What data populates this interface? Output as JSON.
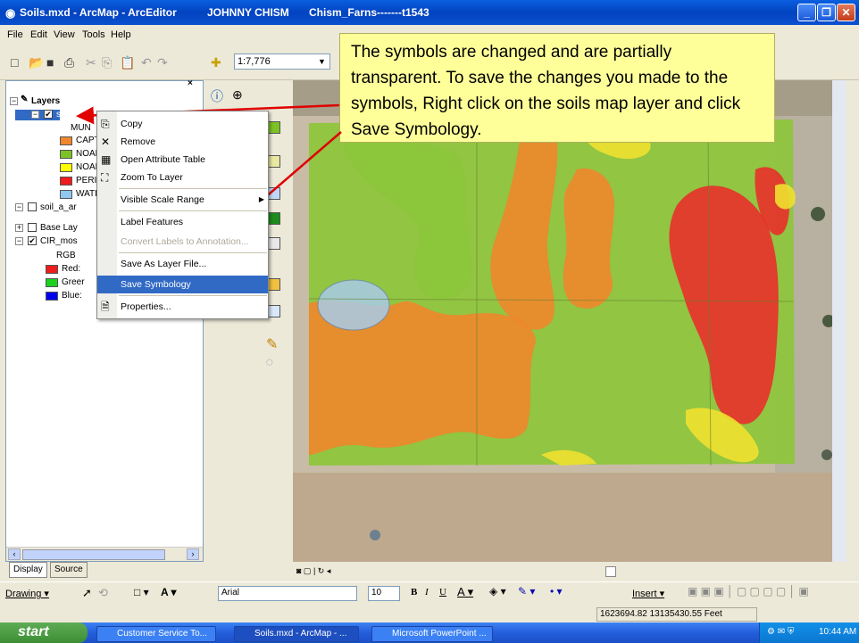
{
  "window": {
    "title": "Soils.mxd - ArcMap - ArcEditor",
    "user": "JOHNNY CHISM",
    "file": "Chism_Farns-------t1543"
  },
  "menu": [
    "File",
    "Edit",
    "View",
    "Tools",
    "Help"
  ],
  "toolbar": {
    "scale": "1:7,776"
  },
  "toc": {
    "root": "Layers",
    "layer1": "soils_ma",
    "layer1_items": [
      {
        "label": "MUN",
        "color": ""
      },
      {
        "label": "CAPT",
        "color": "#f0862c"
      },
      {
        "label": "NOAF",
        "color": "#7cc224"
      },
      {
        "label": "NOAF",
        "color": "#ffff00"
      },
      {
        "label": "PERII",
        "color": "#ee1c1c"
      },
      {
        "label": "WATI",
        "color": "#90c8f0"
      }
    ],
    "layer2": "soil_a_ar",
    "layer3": "Base Lay",
    "layer4": "CIR_mos",
    "layer4_items": [
      {
        "label": "RGB",
        "color": ""
      },
      {
        "label": "Red:",
        "color": "#ee1c1c"
      },
      {
        "label": "Greer",
        "color": "#1cd21c"
      },
      {
        "label": "Blue:",
        "color": "#0000ee"
      }
    ]
  },
  "context_menu": {
    "items": [
      "Copy",
      "Remove",
      "Open Attribute Table",
      "Zoom To Layer",
      "Visible Scale Range",
      "Label Features",
      "Convert Labels to Annotation...",
      "Save As Layer File...",
      "Save Symbology",
      "Properties..."
    ],
    "selected": "Save Symbology"
  },
  "callout": {
    "text": "The symbols are changed and are partially transparent. To save the changes you made to the symbols, Right click on the soils map layer and click Save Symbology."
  },
  "tabs": {
    "display": "Display",
    "source": "Source"
  },
  "drawbar": {
    "drawing": "Drawing ▾",
    "font": "Arial",
    "size": "10",
    "insert": "Insert ▾"
  },
  "status": {
    "coords": "1623694.82  13135430.55 Feet"
  },
  "taskbar": {
    "start": "start",
    "tasks": [
      "Customer Service To...",
      "Soils.mxd - ArcMap - ...",
      "Microsoft PowerPoint ..."
    ],
    "time": "10:44 AM"
  },
  "colors": {
    "captina": "#f0862c",
    "noaf_green": "#8cc63a",
    "noaf_yellow": "#f0e030",
    "perii": "#e8302a",
    "water": "#a8cce8"
  }
}
